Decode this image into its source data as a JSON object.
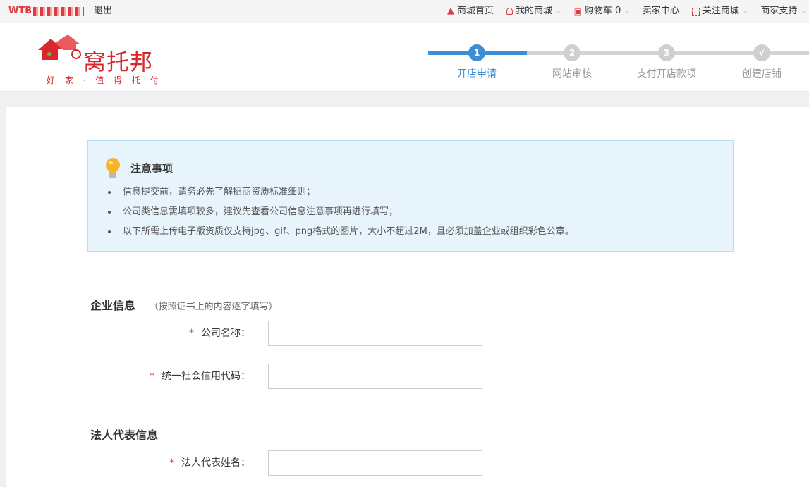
{
  "topbar": {
    "user_name": "WTB",
    "logout": "退出",
    "mall_home": "商城首页",
    "my_mall": "我的商城",
    "cart": "购物车 0",
    "seller_center": "卖家中心",
    "follow_mall": "关注商城",
    "merchant_support": "商家支持"
  },
  "logo": {
    "name": "窝托邦",
    "slogan": "好 家 · 值 得 托 付"
  },
  "steps": [
    {
      "number": "1",
      "label": "开店申请",
      "state": "active"
    },
    {
      "number": "2",
      "label": "网站审核",
      "state": "pending"
    },
    {
      "number": "3",
      "label": "支付开店款项",
      "state": "pending"
    },
    {
      "number": "√",
      "label": "创建店铺",
      "state": "pending"
    }
  ],
  "notice": {
    "title": "注意事项",
    "items": [
      "信息提交前，请务必先了解招商资质标准细则；",
      "公司类信息需填项较多，建议先查看公司信息注意事项再进行填写；",
      "以下所需上传电子版资质仅支持jpg、gif、png格式的图片，大小不超过2M，且必须加盖企业或组织彩色公章。"
    ]
  },
  "company_section": {
    "title": "企业信息",
    "hint": "（按照证书上的内容逐字填写）",
    "fields": [
      {
        "label": "公司名称：",
        "required_mark": "*",
        "value": ""
      },
      {
        "label": "统一社会信用代码：",
        "required_mark": "*",
        "value": ""
      }
    ]
  },
  "legal_section": {
    "title": "法人代表信息",
    "fields": [
      {
        "label": "法人代表姓名：",
        "required_mark": "*",
        "value": ""
      }
    ]
  },
  "colors": {
    "brand_red": "#e4393c",
    "step_active": "#3a8fd8",
    "step_pending": "#cccccc",
    "notice_bg": "#e8f4fc"
  }
}
